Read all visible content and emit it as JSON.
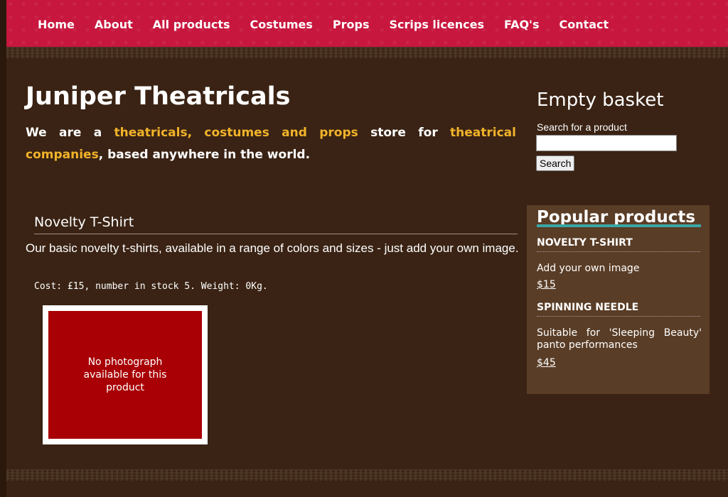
{
  "nav": {
    "items": [
      {
        "label": "Home"
      },
      {
        "label": "About"
      },
      {
        "label": "All products"
      },
      {
        "label": "Costumes"
      },
      {
        "label": "Props"
      },
      {
        "label": "Scrips licences"
      },
      {
        "label": "FAQ's"
      },
      {
        "label": "Contact"
      }
    ]
  },
  "site": {
    "title": "Juniper Theatricals",
    "tagline_1": "We are a ",
    "tagline_hl1": "theatricals, costumes and props",
    "tagline_2": " store for ",
    "tagline_hl2": "theatrical companies",
    "tagline_3": ", based anywhere in the world."
  },
  "product": {
    "title": "Novelty T-Shirt",
    "description": "Our basic novelty t-shirts, available in a range of colors and sizes - just add your own image.",
    "cost_line": "Cost: £15, number in stock 5. Weight: 0Kg.",
    "photo_placeholder": "No photograph available for this product"
  },
  "sidebar": {
    "basket_title": "Empty basket",
    "search_label": "Search for a product",
    "search_value": "",
    "search_button": "Search",
    "popular_title": "Popular products",
    "popular": [
      {
        "name": "NOVELTY T-SHIRT",
        "desc": "Add your own image",
        "price": "$15"
      },
      {
        "name": "SPINNING NEEDLE",
        "desc": "Suitable for 'Sleeping Beauty' panto performances",
        "price": "$45"
      }
    ]
  },
  "colors": {
    "background": "#3a2314",
    "nav": "#c8173e",
    "highlight": "#f2b32a",
    "photo_placeholder": "#a80005",
    "popular_panel": "#5a3d26",
    "popular_accent": "#39a6a6"
  }
}
